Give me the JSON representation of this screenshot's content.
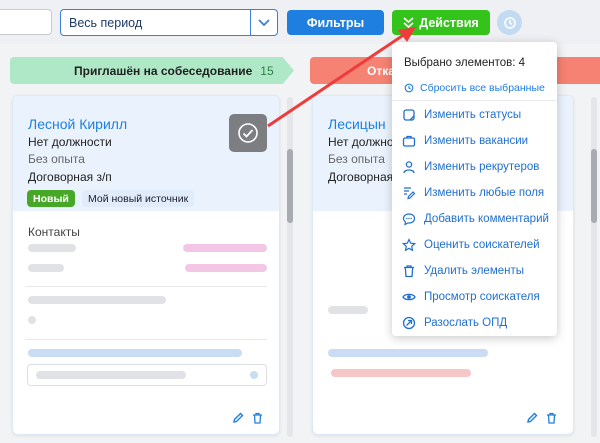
{
  "toolbar": {
    "period_value": "Весь период",
    "filters_label": "Фильтры",
    "actions_label": "Действия"
  },
  "columns": [
    {
      "title": "Приглашён на собеседование",
      "count": "15",
      "color": "#aee8c7"
    },
    {
      "title": "Отка",
      "color": "#f58272"
    }
  ],
  "card1": {
    "name": "Лесной Кирилл",
    "position": "Нет должности",
    "experience": "Без опыта",
    "salary": "Договорная з/п",
    "tag_new": "Новый",
    "tag_source": "Мой новый источник",
    "contacts_title": "Контакты"
  },
  "card2": {
    "name": "Лесицын",
    "position": "Нет должности",
    "experience": "Без опыта",
    "salary": "Договорная"
  },
  "actions_menu": {
    "selected_label": "Выбрано элементов: 4",
    "reset_label": "Сбросить все выбранные",
    "items": [
      {
        "label": "Изменить статусы",
        "icon": "edit-status-icon"
      },
      {
        "label": "Изменить вакансии",
        "icon": "briefcase-icon"
      },
      {
        "label": "Изменить рекрутеров",
        "icon": "user-icon"
      },
      {
        "label": "Изменить любые поля",
        "icon": "edit-fields-icon"
      },
      {
        "label": "Добавить комментарий",
        "icon": "comment-icon"
      },
      {
        "label": "Оценить соискателей",
        "icon": "star-icon"
      },
      {
        "label": "Удалить элементы",
        "icon": "trash-icon"
      },
      {
        "label": "Просмотр соискателя",
        "icon": "eye-icon"
      },
      {
        "label": "Разослать ОПД",
        "icon": "send-icon"
      }
    ]
  },
  "colors": {
    "primary": "#1f7fe0",
    "success": "#34c31a",
    "arrow": "#ef3b3b"
  }
}
